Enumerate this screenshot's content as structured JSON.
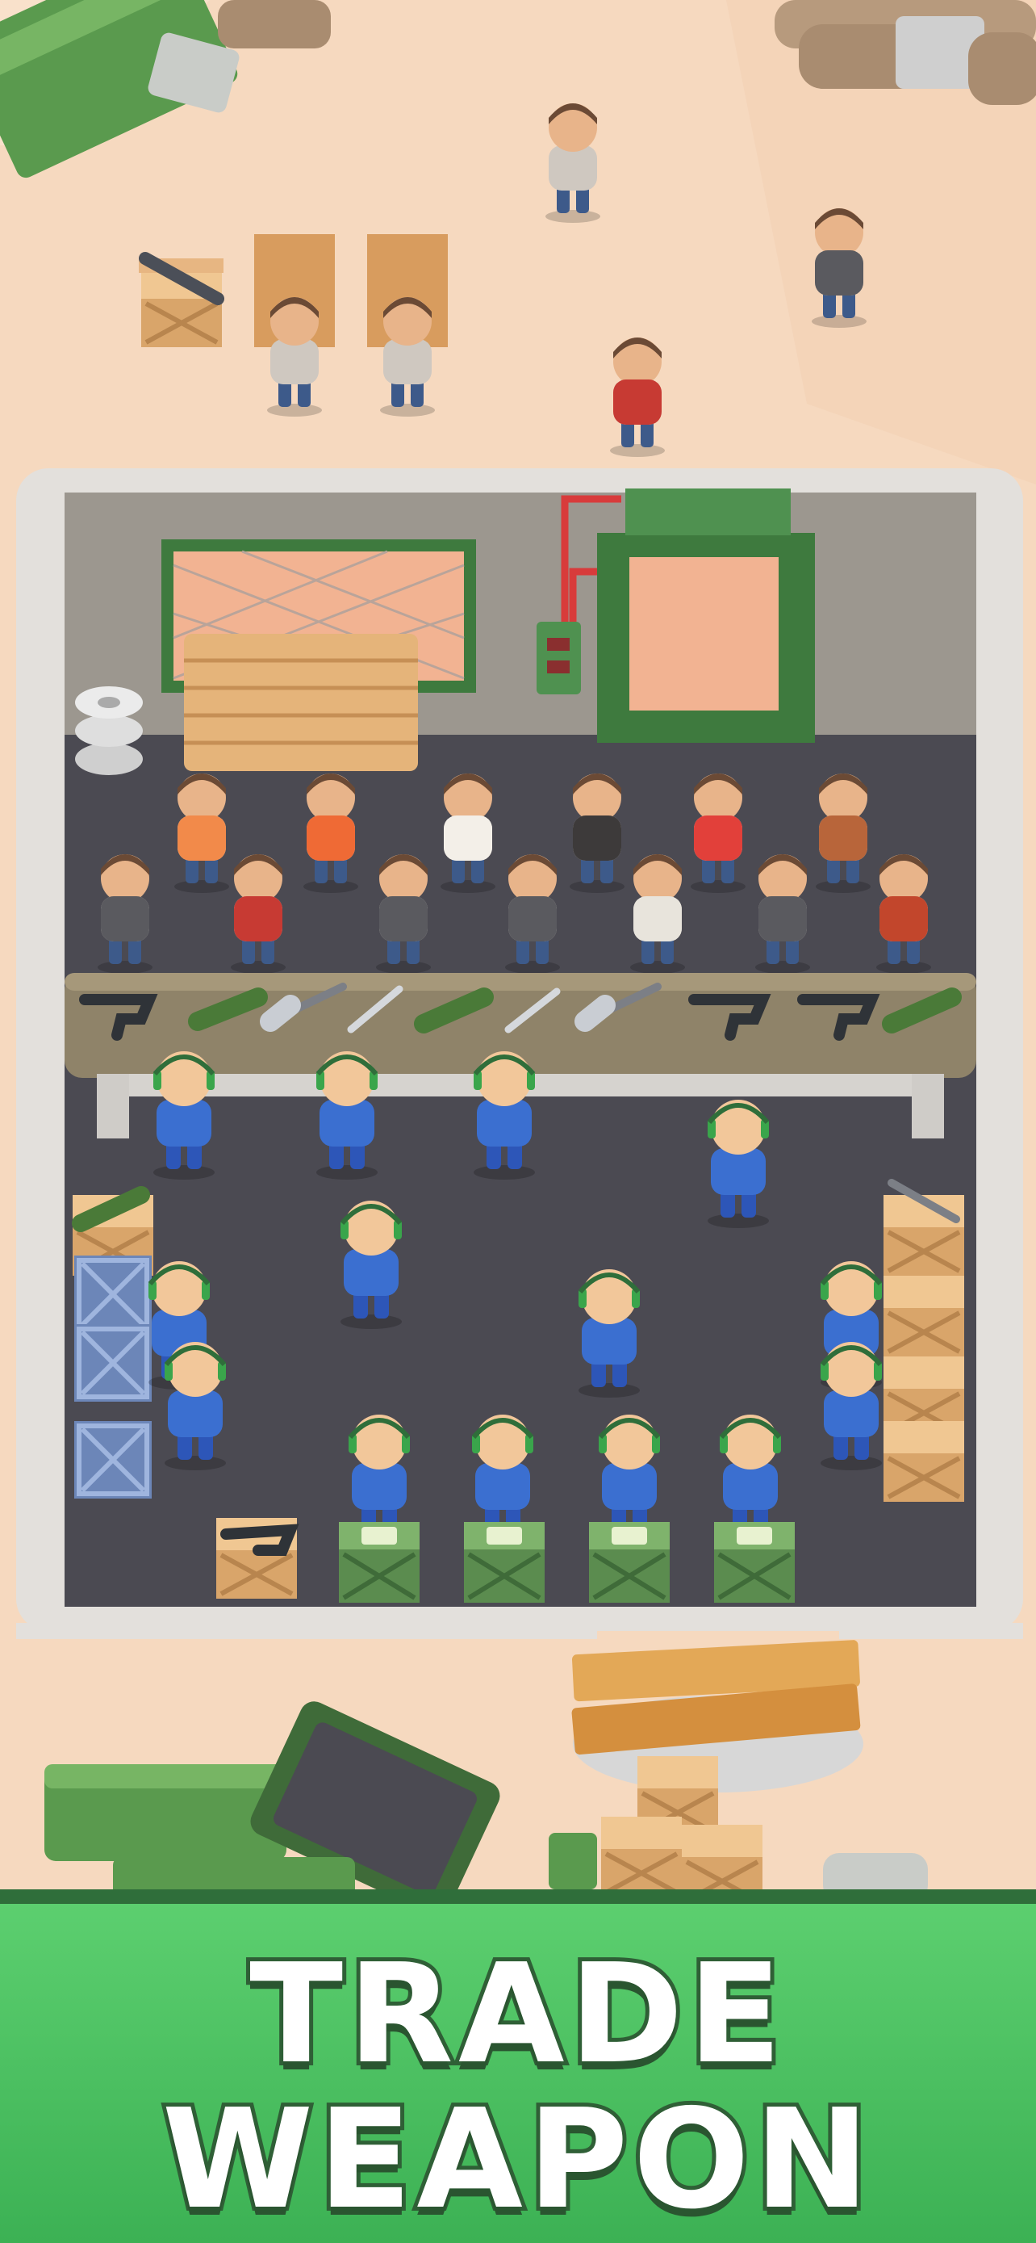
{
  "banner": {
    "line1": "TRADE",
    "line2": "WEAPON"
  },
  "colors": {
    "sand": "#f6d9bf",
    "floor": "#4b4a52",
    "wall": "#d9d6d2",
    "counter": "#8f8369",
    "crate_green": "#5b8c4f",
    "crate_wood": "#e3b77d",
    "banner_green": "#4cc463",
    "guard_blue": "#3b6fd0"
  },
  "scene": {
    "customers_queue_count": 14,
    "clerks_count": 4,
    "workers_count": 10
  }
}
